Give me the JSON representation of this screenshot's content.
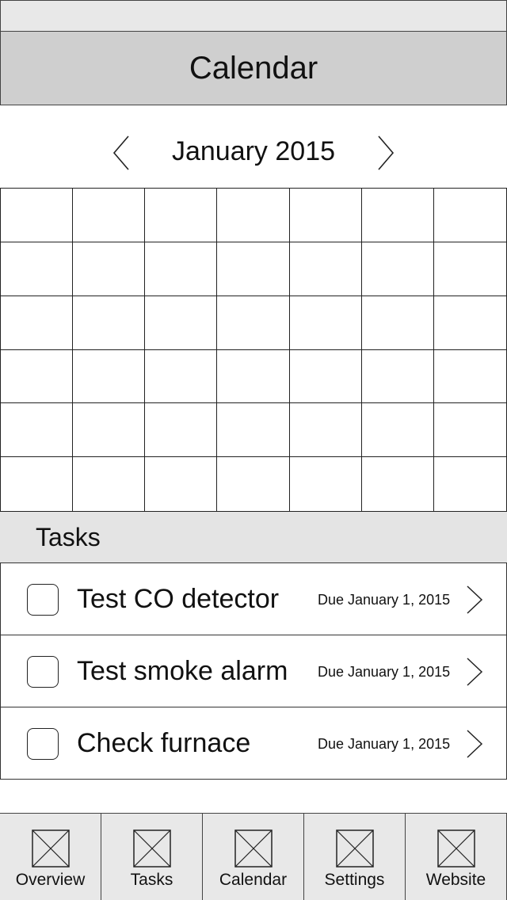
{
  "header": {
    "title": "Calendar"
  },
  "calendar": {
    "month_label": "January 2015",
    "rows": 6,
    "cols": 7
  },
  "tasks": {
    "heading": "Tasks",
    "items": [
      {
        "name": "Test CO detector",
        "due": "Due January 1, 2015"
      },
      {
        "name": "Test smoke alarm",
        "due": "Due January 1, 2015"
      },
      {
        "name": "Check furnace",
        "due": "Due January 1, 2015"
      }
    ]
  },
  "tab_bar": {
    "tabs": [
      {
        "label": "Overview",
        "icon": "placeholder-image-icon"
      },
      {
        "label": "Tasks",
        "icon": "placeholder-image-icon"
      },
      {
        "label": "Calendar",
        "icon": "placeholder-image-icon"
      },
      {
        "label": "Settings",
        "icon": "placeholder-image-icon"
      },
      {
        "label": "Website",
        "icon": "placeholder-image-icon"
      }
    ]
  }
}
